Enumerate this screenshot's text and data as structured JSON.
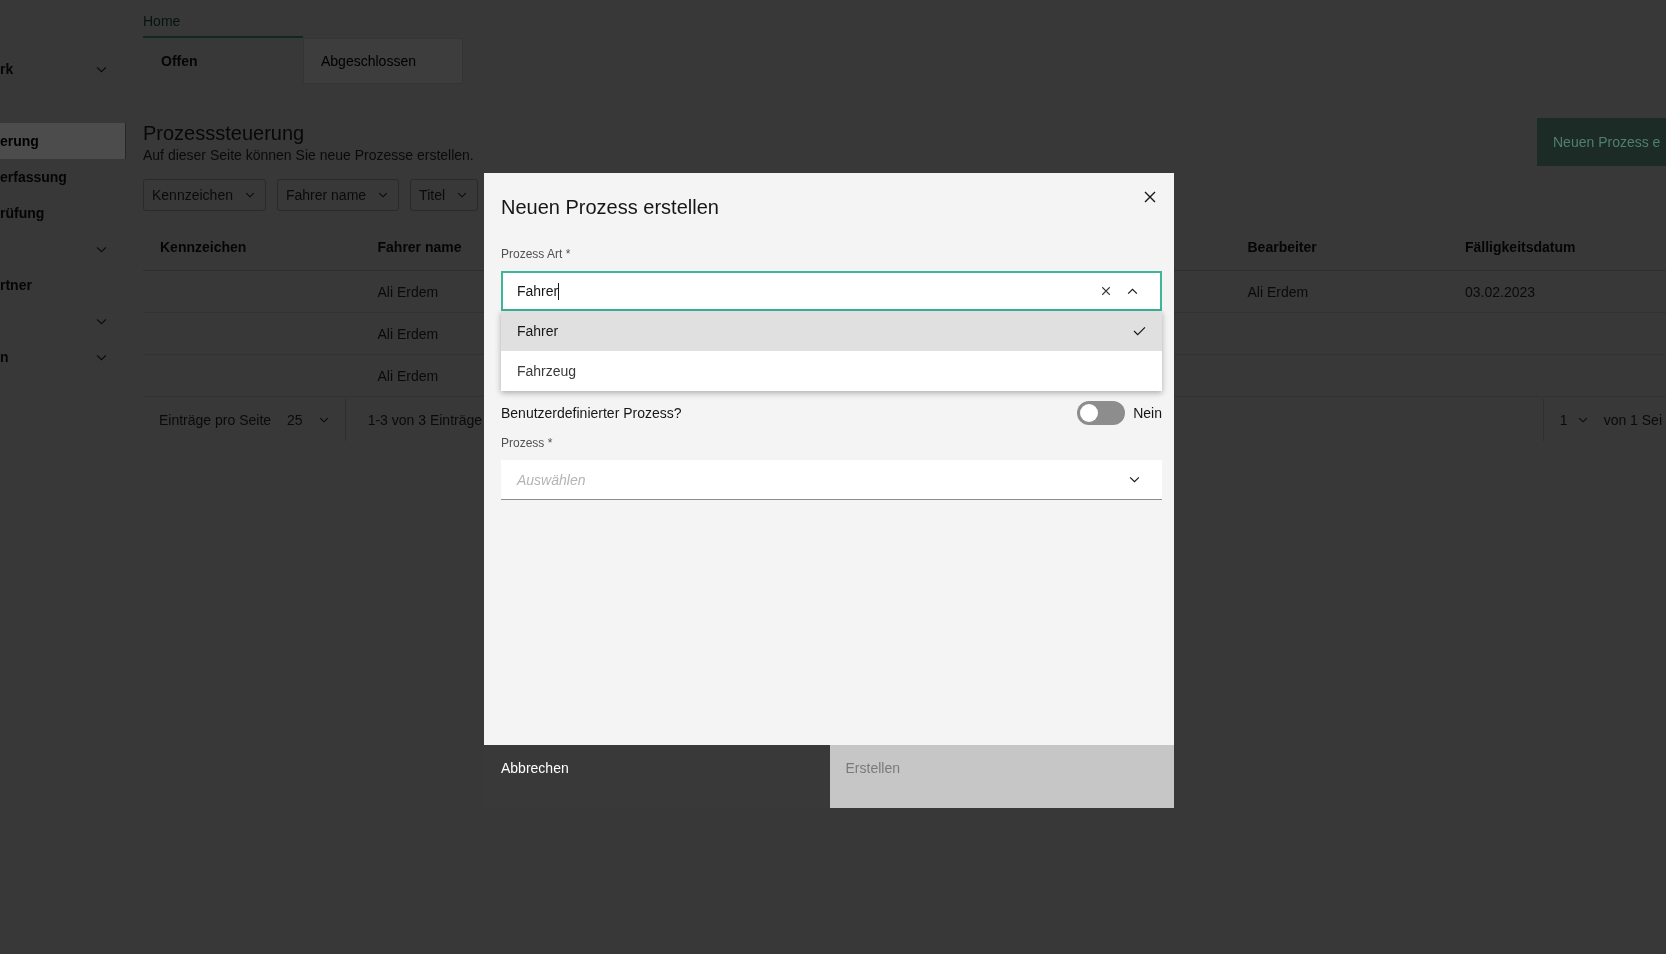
{
  "sidebar": {
    "items": [
      {
        "label": "rk",
        "has_submenu": true,
        "selected": false
      },
      {
        "label": "erung",
        "has_submenu": false,
        "selected": true
      },
      {
        "label": "erfassung",
        "has_submenu": false,
        "selected": false
      },
      {
        "label": "rüfung",
        "has_submenu": false,
        "selected": false
      },
      {
        "has_submenu": true,
        "selected": false
      },
      {
        "label": "rtner",
        "has_submenu": false,
        "selected": false
      },
      {
        "has_submenu": true,
        "selected": false
      },
      {
        "label": "n",
        "has_submenu": true,
        "selected": false
      }
    ]
  },
  "nav_tabs": [
    {
      "label": "Home",
      "selected": true
    }
  ],
  "tabs": [
    {
      "label": "Offen",
      "selected": true
    },
    {
      "label": "Abgeschlossen",
      "selected": false
    }
  ],
  "page": {
    "title": "Prozesssteuerung",
    "description": "Auf dieser Seite können Sie neue Prozesse erstellen.",
    "primary_button": "Neuen Prozess e"
  },
  "filters": [
    {
      "label": "Kennzeichen"
    },
    {
      "label": "Fahrer name"
    },
    {
      "label": "Titel"
    }
  ],
  "table": {
    "columns": [
      "Kennzeichen",
      "Fahrer name",
      "Bearbeiter",
      "Fälligkeitsdatum"
    ],
    "rows": [
      {
        "cells": [
          null,
          "Ali Erdem",
          "Ali Erdem",
          "03.02.2023"
        ]
      },
      {
        "cells": [
          null,
          "Ali Erdem",
          null,
          null
        ]
      },
      {
        "cells": [
          null,
          "Ali Erdem",
          null,
          null
        ]
      }
    ]
  },
  "pagination": {
    "per_page_label": "Einträge pro Seite",
    "per_page": "25",
    "range": "1-3 von 3 Einträge",
    "page": "1",
    "page_total": "von 1 Sei"
  },
  "modal": {
    "title": "Neuen Prozess erstellen",
    "fields": [
      {
        "kind": "combobox",
        "label": "Prozess Art *",
        "value": "Fahrer",
        "focused": true,
        "expanded": true,
        "options": [
          {
            "label": "Fahrer",
            "selected": true
          },
          {
            "label": "Fahrzeug",
            "selected": false
          }
        ]
      },
      {
        "kind": "toggle",
        "label": "Benutzerdefinierter Prozess?",
        "on": false,
        "state_text": "Nein"
      },
      {
        "kind": "select",
        "label": "Prozess *",
        "placeholder": "Auswählen"
      }
    ],
    "buttons": [
      {
        "label": "Abbrechen",
        "kind": "secondary",
        "disabled": false
      },
      {
        "label": "Erstellen",
        "kind": "primary",
        "disabled": true
      }
    ]
  }
}
